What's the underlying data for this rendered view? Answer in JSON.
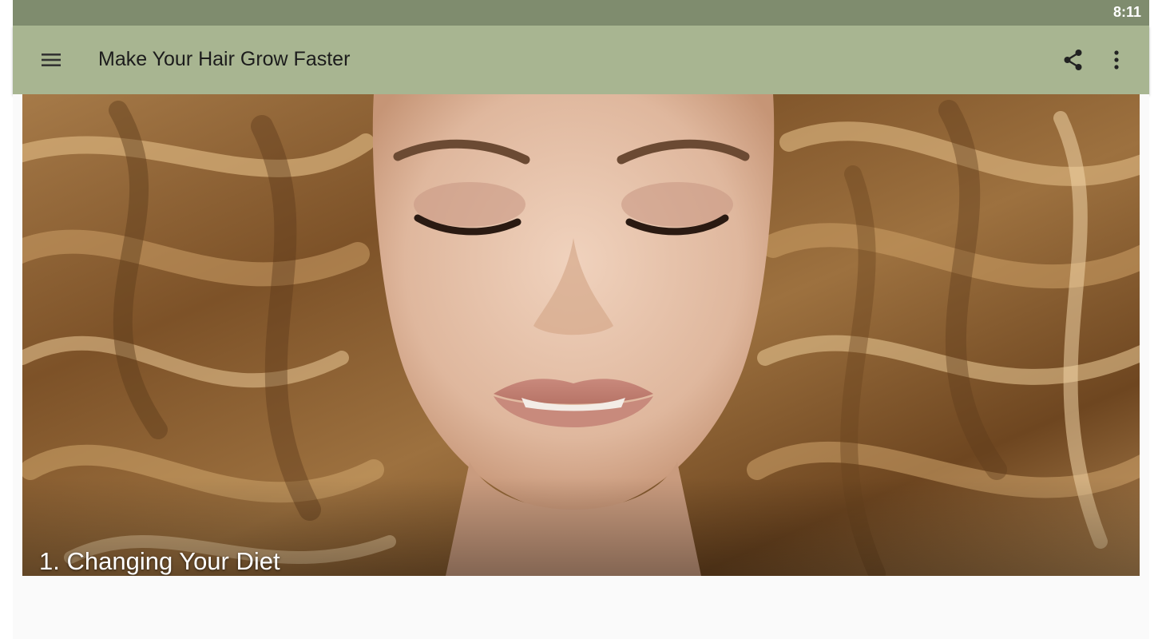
{
  "status_bar": {
    "time": "8:11"
  },
  "app_bar": {
    "title": "Make Your Hair Grow Faster",
    "menu_icon": "hamburger-menu-icon",
    "share_icon": "share-icon",
    "more_icon": "more-vert-icon"
  },
  "article": {
    "image_subject": "woman-with-long-wavy-blonde-hair",
    "caption": "1. Changing Your Diet"
  },
  "colors": {
    "status_bar": "#7f8c6e",
    "app_bar": "#a8b591",
    "content_bg": "#fafafa"
  }
}
